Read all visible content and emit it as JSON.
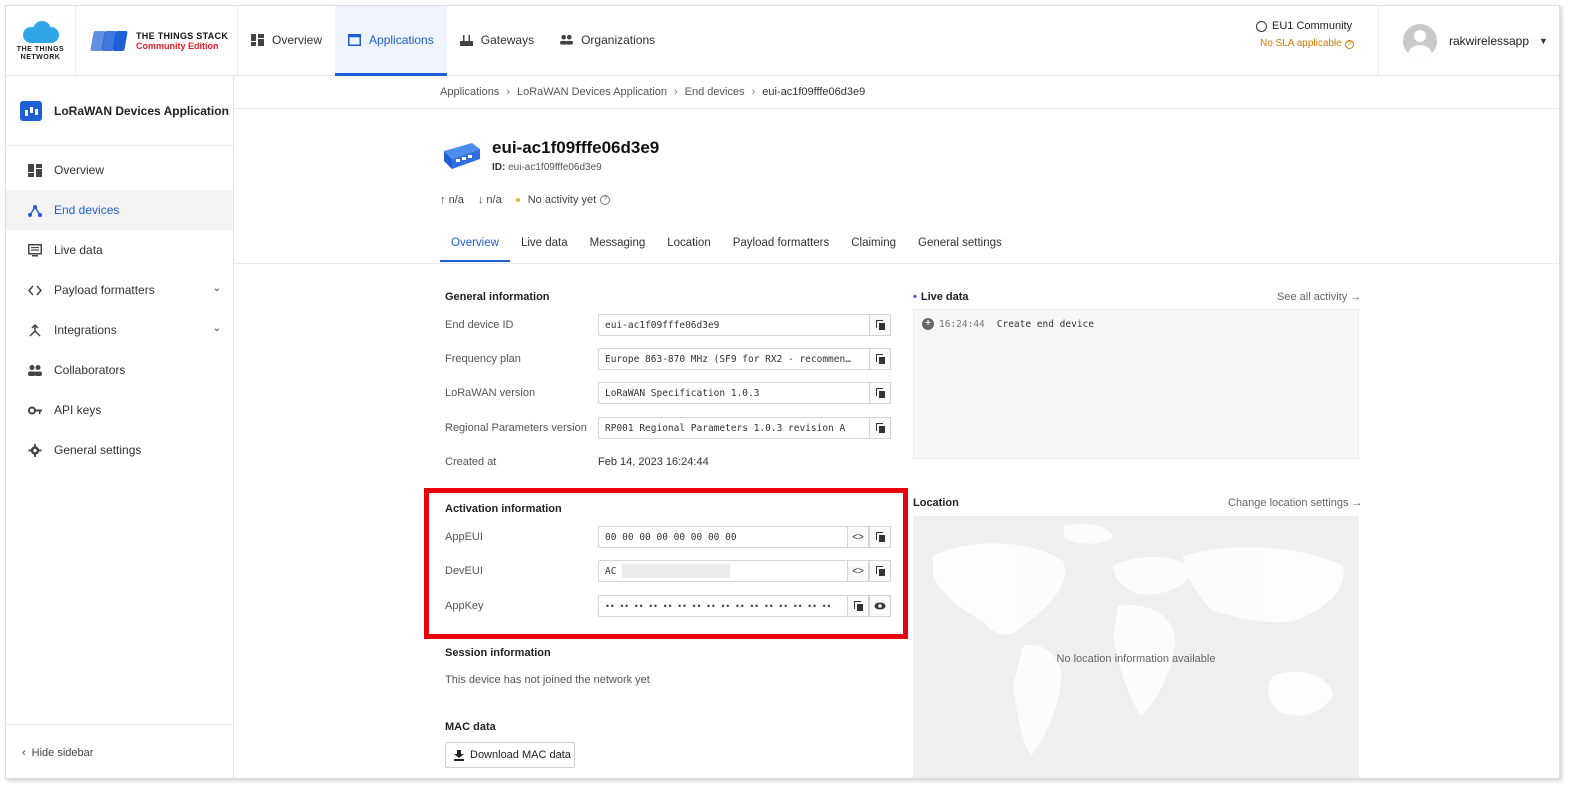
{
  "brand": {
    "ttn_text": "THE THINGS NETWORK",
    "tts_name": "THE THINGS STACK",
    "tts_edition": "Community Edition"
  },
  "topnav": {
    "items": [
      {
        "label": "Overview",
        "icon": "dashboard-icon",
        "active": false
      },
      {
        "label": "Applications",
        "icon": "application-icon",
        "active": true
      },
      {
        "label": "Gateways",
        "icon": "gateway-icon",
        "active": false
      },
      {
        "label": "Organizations",
        "icon": "organization-icon",
        "active": false
      }
    ],
    "region": "EU1 Community",
    "sla": "No SLA applicable",
    "username": "rakwirelessapp"
  },
  "sidebar": {
    "app_title": "LoRaWAN Devices Application",
    "items": [
      {
        "label": "Overview",
        "icon": "dashboard-icon"
      },
      {
        "label": "End devices",
        "icon": "end-devices-icon",
        "active": true
      },
      {
        "label": "Live data",
        "icon": "live-data-icon"
      },
      {
        "label": "Payload formatters",
        "icon": "code-icon",
        "expandable": true
      },
      {
        "label": "Integrations",
        "icon": "integrations-icon",
        "expandable": true
      },
      {
        "label": "Collaborators",
        "icon": "people-icon"
      },
      {
        "label": "API keys",
        "icon": "key-icon"
      },
      {
        "label": "General settings",
        "icon": "gear-icon"
      }
    ],
    "hide_label": "Hide sidebar"
  },
  "breadcrumb": [
    "Applications",
    "LoRaWAN Devices Application",
    "End devices",
    "eui-ac1f09fffe06d3e9"
  ],
  "device": {
    "name": "eui-ac1f09fffe06d3e9",
    "id_label": "ID:",
    "id": "eui-ac1f09fffe06d3e9",
    "uplink": "n/a",
    "downlink": "n/a",
    "activity": "No activity yet"
  },
  "tabs": [
    "Overview",
    "Live data",
    "Messaging",
    "Location",
    "Payload formatters",
    "Claiming",
    "General settings"
  ],
  "general": {
    "title": "General information",
    "fields": [
      {
        "label": "End device ID",
        "value": "eui-ac1f09fffe06d3e9"
      },
      {
        "label": "Frequency plan",
        "value": "Europe 863-870 MHz (SF9 for RX2 - recommen…"
      },
      {
        "label": "LoRaWAN version",
        "value": "LoRaWAN Specification 1.0.3"
      },
      {
        "label": "Regional Parameters version",
        "value": "RP001 Regional Parameters 1.0.3 revision A"
      }
    ],
    "created_label": "Created at",
    "created_value": "Feb 14, 2023 16:24:44"
  },
  "activation": {
    "title": "Activation information",
    "appeui_label": "AppEUI",
    "appeui_value": "00 00 00 00 00 00 00 00",
    "deveui_label": "DevEUI",
    "deveui_value": "AC",
    "appkey_label": "AppKey",
    "appkey_value": "•• •• •• •• •• •• •• •• •• •• •• •• •• •• •• ••"
  },
  "session": {
    "title": "Session information",
    "text": "This device has not joined the network yet"
  },
  "mac": {
    "title": "MAC data",
    "button": "Download MAC data"
  },
  "live": {
    "title": "Live data",
    "link": "See all activity →",
    "time": "16:24:44",
    "event": "Create end device"
  },
  "location": {
    "title": "Location",
    "link": "Change location settings →",
    "empty": "No location information available"
  },
  "colors": {
    "accent": "#1f5fd6",
    "highlight": "#e8000b",
    "sla": "#d17a00"
  }
}
